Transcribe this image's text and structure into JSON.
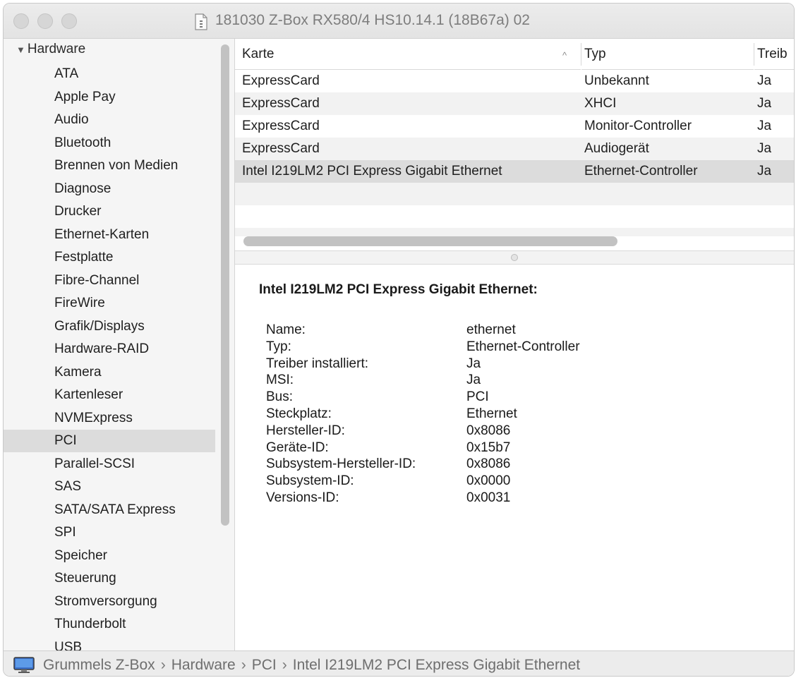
{
  "window": {
    "title": "181030 Z-Box RX580/4 HS10.14.1 (18B67a) 02"
  },
  "sidebar": {
    "section": "Hardware",
    "items": [
      "ATA",
      "Apple Pay",
      "Audio",
      "Bluetooth",
      "Brennen von Medien",
      "Diagnose",
      "Drucker",
      "Ethernet-Karten",
      "Festplatte",
      "Fibre-Channel",
      "FireWire",
      "Grafik/Displays",
      "Hardware-RAID",
      "Kamera",
      "Kartenleser",
      "NVMExpress",
      "PCI",
      "Parallel-SCSI",
      "SAS",
      "SATA/SATA Express",
      "SPI",
      "Speicher",
      "Steuerung",
      "Stromversorgung",
      "Thunderbolt",
      "USB"
    ],
    "selected": "PCI"
  },
  "table": {
    "columns": {
      "karte": "Karte",
      "typ": "Typ",
      "treiber": "Treib"
    },
    "rows": [
      {
        "karte": "ExpressCard",
        "typ": "Unbekannt",
        "treiber": "Ja"
      },
      {
        "karte": "ExpressCard",
        "typ": "XHCI",
        "treiber": "Ja"
      },
      {
        "karte": "ExpressCard",
        "typ": "Monitor-Controller",
        "treiber": "Ja"
      },
      {
        "karte": "ExpressCard",
        "typ": "Audiogerät",
        "treiber": "Ja"
      },
      {
        "karte": "Intel I219LM2 PCI Express Gigabit Ethernet",
        "typ": "Ethernet-Controller",
        "treiber": "Ja"
      }
    ]
  },
  "detail": {
    "title": "Intel I219LM2 PCI Express Gigabit Ethernet:",
    "fields": [
      {
        "label": "Name:",
        "value": "ethernet"
      },
      {
        "label": "Typ:",
        "value": "Ethernet-Controller"
      },
      {
        "label": "Treiber installiert:",
        "value": "Ja"
      },
      {
        "label": "MSI:",
        "value": "Ja"
      },
      {
        "label": "Bus:",
        "value": "PCI"
      },
      {
        "label": "Steckplatz:",
        "value": "Ethernet"
      },
      {
        "label": "Hersteller-ID:",
        "value": "0x8086"
      },
      {
        "label": "Geräte-ID:",
        "value": "0x15b7"
      },
      {
        "label": "Subsystem-Hersteller-ID:",
        "value": "0x8086"
      },
      {
        "label": "Subsystem-ID:",
        "value": "0x0000"
      },
      {
        "label": "Versions-ID:",
        "value": "0x0031"
      }
    ]
  },
  "statusbar": {
    "crumbs": [
      "Grummels Z-Box",
      "Hardware",
      "PCI",
      "Intel I219LM2 PCI Express Gigabit Ethernet"
    ],
    "separator": "›"
  }
}
